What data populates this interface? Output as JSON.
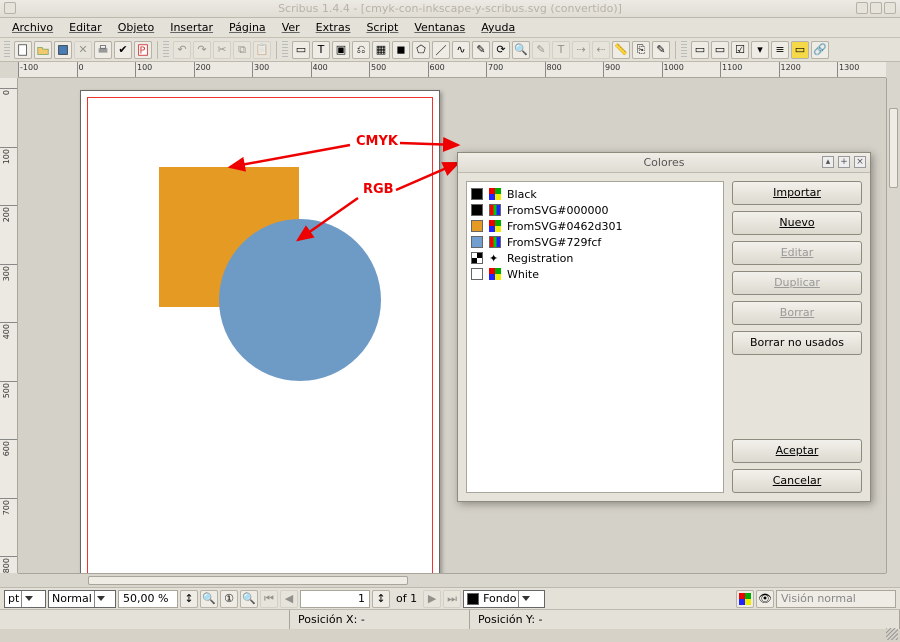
{
  "titlebar": {
    "text": "Scribus 1.4.4 - [cmyk-con-inkscape-y-scribus.svg (convertido)]"
  },
  "menu": {
    "items": [
      "Archivo",
      "Editar",
      "Objeto",
      "Insertar",
      "Página",
      "Ver",
      "Extras",
      "Script",
      "Ventanas",
      "Ayuda"
    ]
  },
  "annotations": {
    "cmyk": "CMYK",
    "rgb": "RGB"
  },
  "canvas": {
    "square_color": "#e59a23",
    "circle_color": "#6e9ac6"
  },
  "colores_dialog": {
    "title": "Colores",
    "list": [
      {
        "swatch": "#000000",
        "space": "cmyk",
        "name": "Black"
      },
      {
        "swatch": "#000000",
        "space": "rgb",
        "name": "FromSVG#000000"
      },
      {
        "swatch": "#e59a23",
        "space": "cmyk",
        "name": "FromSVG#0462d301"
      },
      {
        "swatch": "#729fcf",
        "space": "rgb",
        "name": "FromSVG#729fcf"
      },
      {
        "swatch": "registration",
        "space": "reg",
        "name": "Registration"
      },
      {
        "swatch": "#ffffff",
        "space": "cmyk",
        "name": "White"
      }
    ],
    "buttons": {
      "import": "Importar",
      "new": "Nuevo",
      "edit": "Editar",
      "duplicate": "Duplicar",
      "delete": "Borrar",
      "delete_unused": "Borrar no usados",
      "ok": "Aceptar",
      "cancel": "Cancelar"
    }
  },
  "statusbar": {
    "unit": "pt",
    "zoom_mode": "Normal",
    "zoom_value": "50,00 %",
    "page_current": "1",
    "page_total_label": "of 1",
    "layer": "Fondo",
    "preview_mode": "Visión normal",
    "pos_x_label": "Posición X:",
    "pos_x_value": "-",
    "pos_y_label": "Posición Y:",
    "pos_y_value": "-"
  }
}
